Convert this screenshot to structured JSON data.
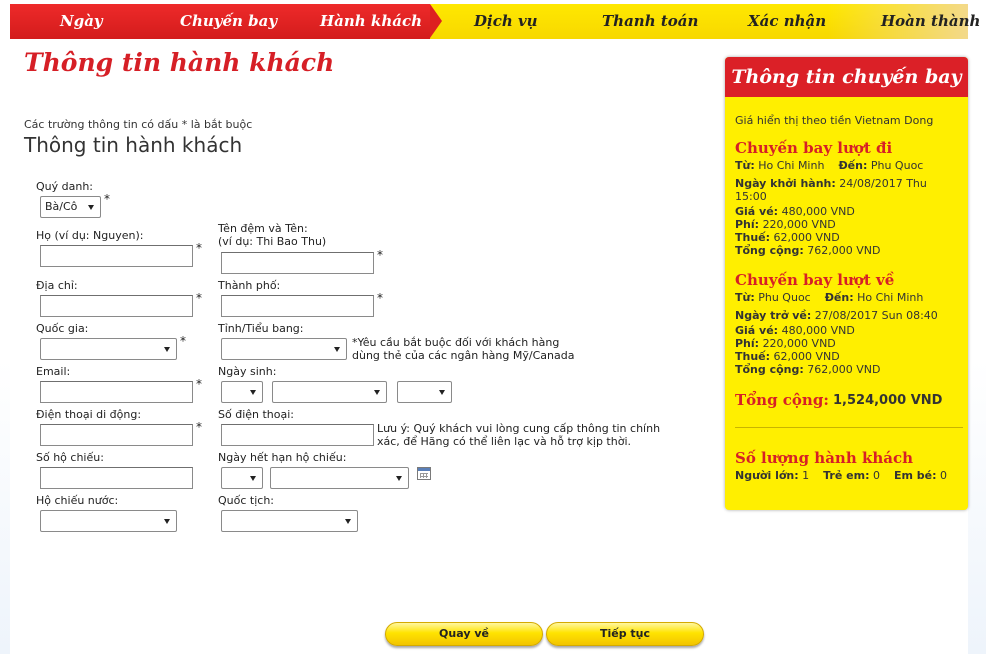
{
  "steps": [
    "Ngày",
    "Chuyến bay",
    "Hành khách",
    "Dịch vụ",
    "Thanh toán",
    "Xác nhận",
    "Hoàn thành"
  ],
  "page_title": "Thông tin hành khách",
  "required_note": "Các trường thông tin có dấu * là bắt buộc",
  "section_title": "Thông tin hành khách",
  "form": {
    "title_label": "Quý danh:",
    "title_value": "Bà/Cô",
    "last_name_label": "Họ (ví dụ: Nguyen):",
    "given_name_label_1": "Tên đệm và Tên:",
    "given_name_label_2": "(ví dụ: Thi Bao Thu)",
    "address_label": "Địa chỉ:",
    "city_label": "Thành phố:",
    "country_label": "Quốc gia:",
    "state_label": "Tỉnh/Tiểu bang:",
    "state_note_1": "*Yêu cầu bắt buộc đối với khách hàng",
    "state_note_2": "dùng thẻ của các ngân hàng Mỹ/Canada",
    "email_label": "Email:",
    "dob_label": "Ngày sinh:",
    "mobile_label": "Điện thoại di động:",
    "phone_label": "Số điện thoại:",
    "phone_note_1": "Lưu ý: Quý khách vui lòng cung cấp thông tin chính",
    "phone_note_2": "xác, để Hãng có thể liên lạc và hỗ trợ kịp thời.",
    "passport_label": "Số hộ chiếu:",
    "passport_expiry_label": "Ngày hết hạn hộ chiếu:",
    "passport_country_label": "Hộ chiếu nước:",
    "nationality_label": "Quốc tịch:",
    "required_mark": "*"
  },
  "buttons": {
    "back": "Quay về",
    "next": "Tiếp tục"
  },
  "sidebar": {
    "title": "Thông tin chuyến bay",
    "currency_note": "Giá hiển thị theo tiền Vietnam Dong",
    "outbound": {
      "heading": "Chuyến bay lượt đi",
      "from_label": "Từ:",
      "from": "Ho Chi Minh",
      "to_label": "Đến:",
      "to": "Phu Quoc",
      "date_label": "Ngày khởi hành:",
      "date_1": "24/08/2017 Thu",
      "date_2": "15:00",
      "fare_label": "Giá vé:",
      "fare": "480,000 VND",
      "fee_label": "Phí:",
      "fee": "220,000 VND",
      "tax_label": "Thuế:",
      "tax": "62,000 VND",
      "total_label": "Tổng cộng:",
      "total": "762,000 VND"
    },
    "return": {
      "heading": "Chuyến bay lượt về",
      "from_label": "Từ:",
      "from": "Phu Quoc",
      "to_label": "Đến:",
      "to": "Ho Chi Minh",
      "date_label": "Ngày trở về:",
      "date": "27/08/2017 Sun 08:40",
      "fare_label": "Giá vé:",
      "fare": "480,000 VND",
      "fee_label": "Phí:",
      "fee": "220,000 VND",
      "tax_label": "Thuế:",
      "tax": "62,000 VND",
      "total_label": "Tổng cộng:",
      "total": "762,000 VND"
    },
    "grand_total_label": "Tổng cộng:",
    "grand_total": "1,524,000 VND",
    "pax_heading": "Số lượng hành khách",
    "adult_label": "Người lớn:",
    "adult": "1",
    "child_label": "Trẻ em:",
    "child": "0",
    "infant_label": "Em bé:",
    "infant": "0"
  }
}
